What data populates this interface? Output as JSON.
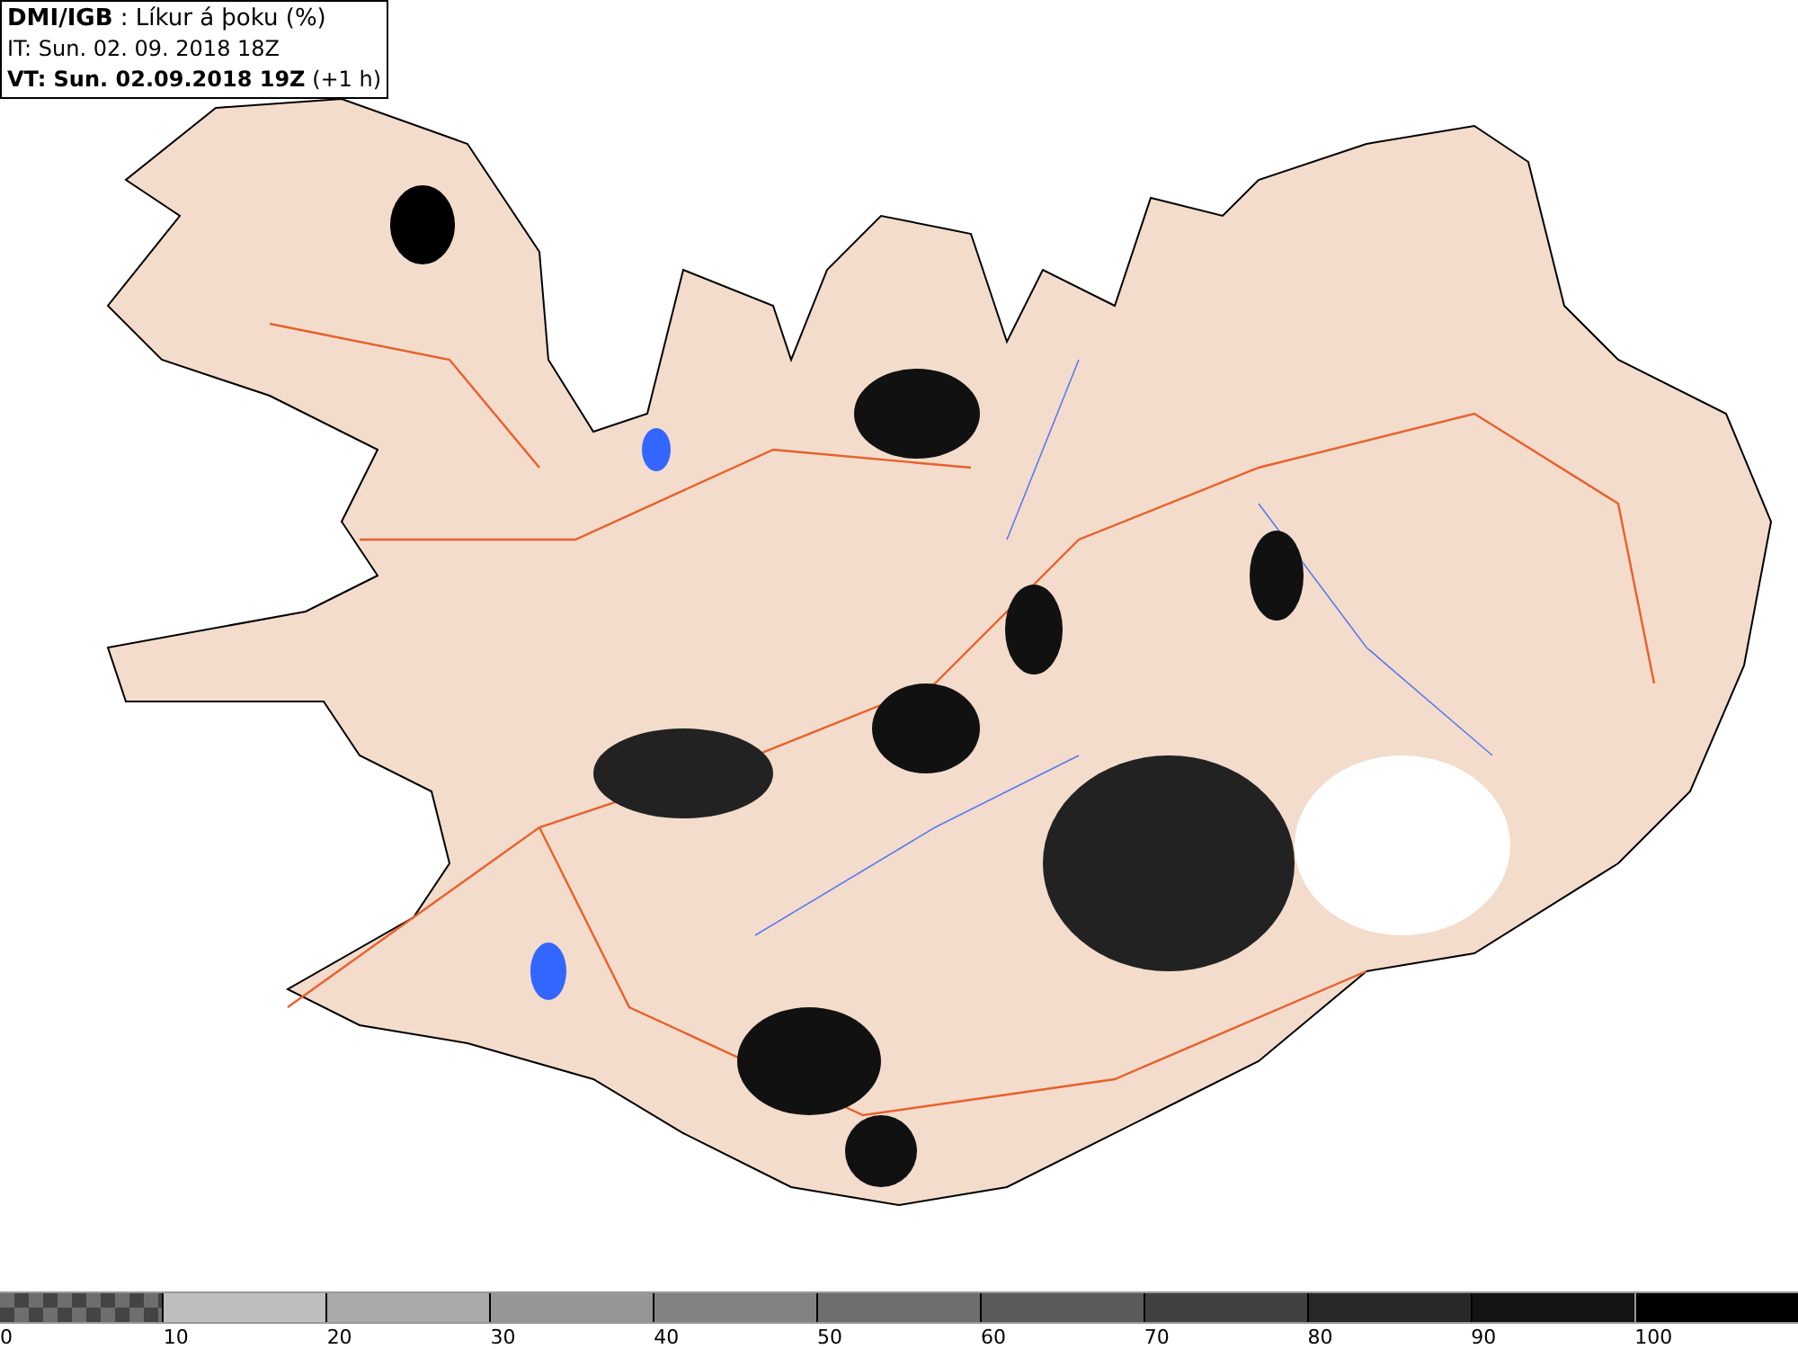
{
  "header": {
    "lines": [
      "**DMI/IGB** : Líkur á þoku (%)",
      "IT: Sun. 02. 09. 2018 18Z",
      "**VT: Sun. 02.09.2018 19Z** (+1 h)"
    ]
  },
  "legend": {
    "segments": [
      {
        "kind": "checker",
        "color": "#6e6e6e"
      },
      {
        "kind": "solid",
        "color": "#bebebe"
      },
      {
        "kind": "solid",
        "color": "#aaaaaa"
      },
      {
        "kind": "solid",
        "color": "#969696"
      },
      {
        "kind": "solid",
        "color": "#828282"
      },
      {
        "kind": "solid",
        "color": "#6e6e6e"
      },
      {
        "kind": "solid",
        "color": "#5a5a5a"
      },
      {
        "kind": "solid",
        "color": "#414141"
      },
      {
        "kind": "solid",
        "color": "#282828"
      },
      {
        "kind": "solid",
        "color": "#141414"
      },
      {
        "kind": "solid",
        "color": "#000000"
      }
    ],
    "labels": [
      "0",
      "10",
      "20",
      "30",
      "40",
      "50",
      "60",
      "70",
      "80",
      "90",
      "100"
    ]
  }
}
